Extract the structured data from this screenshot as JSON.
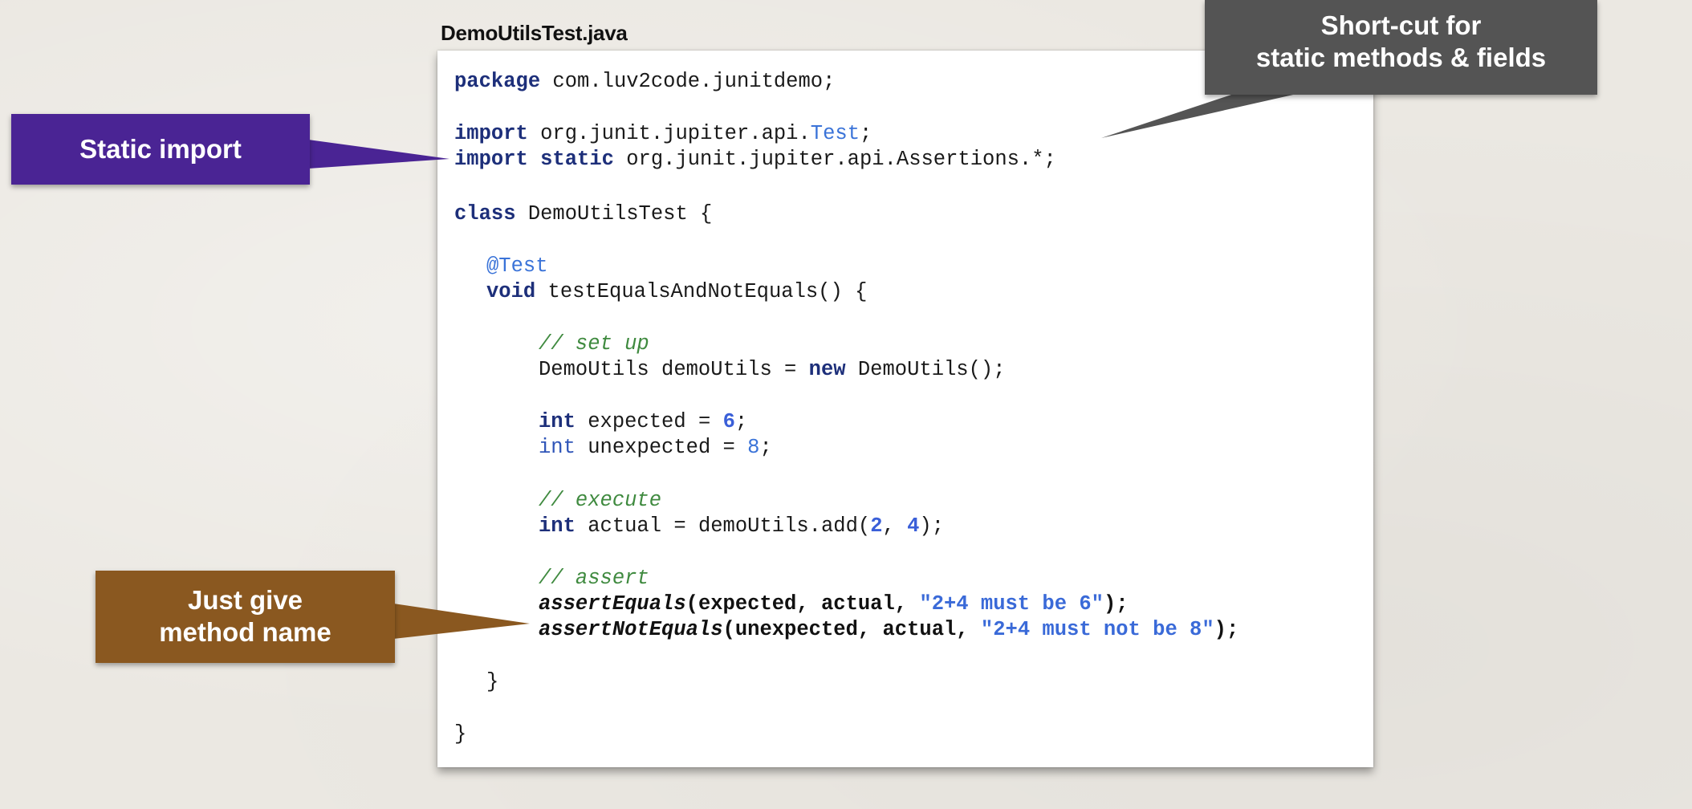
{
  "slide": {
    "file_label": "DemoUtilsTest.java"
  },
  "code": {
    "package_kw": "package",
    "package_name": " com.luv2code.junitdemo;",
    "import_kw_1": "import",
    "import_path_1": " org.junit.jupiter.api.",
    "import_type_1": "Test",
    "import_end_1": ";",
    "import_kw_2": "import static",
    "import_path_2": " org.junit.jupiter.api.Assertions.*;",
    "class_kw": "class",
    "class_decl": " DemoUtilsTest {",
    "annotation": "@Test",
    "void_kw": "void",
    "method_decl": " testEqualsAndNotEquals() {",
    "comment_setup": "// set up",
    "setup_a": "DemoUtils demoUtils = ",
    "new_kw": "new",
    "setup_b": " DemoUtils();",
    "int_kw": "int",
    "expected_a": " expected = ",
    "expected_val": "6",
    "semicolon": ";",
    "int_kw_plain": "int",
    "unexpected_a": " unexpected = ",
    "unexpected_val": "8",
    "comment_execute": "// execute",
    "actual_a": " actual = demoUtils.add(",
    "actual_arg1": "2",
    "actual_comma": ", ",
    "actual_arg2": "4",
    "actual_end": ");",
    "comment_assert": "// assert",
    "assert_eq_fn": "assertEquals",
    "assert_eq_args": "(expected, actual, ",
    "assert_eq_msg": "\"2+4 must be 6\"",
    "assert_end": ");",
    "assert_neq_fn": "assertNotEquals",
    "assert_neq_args": "(unexpected, actual, ",
    "assert_neq_msg": "\"2+4 must not be 8\"",
    "close_method": "}",
    "close_class": "}"
  },
  "callouts": {
    "static_import": "Static import",
    "shortcut_line1": "Short-cut for",
    "shortcut_line2": "static methods & fields",
    "method_line1": "Just give",
    "method_line2": "method name"
  },
  "colors": {
    "keyword": "#1d2f7a",
    "type": "#3a73d8",
    "comment": "#3f8a3f",
    "static_callout": "#4a2494",
    "shortcut_callout": "#545454",
    "method_callout": "#8a5820"
  }
}
